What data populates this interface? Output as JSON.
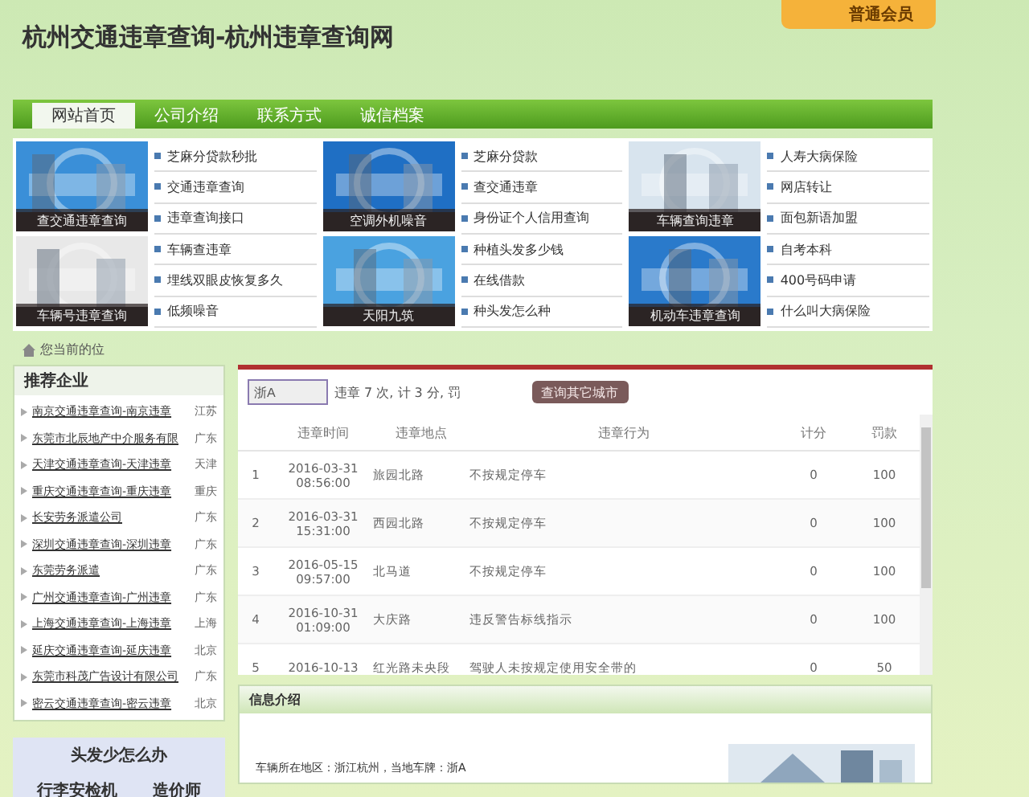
{
  "header": {
    "title": "杭州交通违章查询-杭州违章查询网",
    "member_badge": "普通会员"
  },
  "nav": [
    {
      "label": "网站首页",
      "selected": true
    },
    {
      "label": "公司介绍",
      "selected": false
    },
    {
      "label": "联系方式",
      "selected": false
    },
    {
      "label": "诚信档案",
      "selected": false
    }
  ],
  "promo_columns": [
    {
      "tiles": [
        {
          "kind": "picture",
          "caption": "查交通违章查询"
        },
        {
          "kind": "picture",
          "caption": "车辆号违章查询"
        }
      ],
      "links": [
        "芝麻分贷款秒批",
        "交通违章查询",
        "违章查询接口",
        "车辆查违章",
        "埋线双眼皮恢复多久",
        "低频噪音"
      ]
    },
    {
      "tiles": [
        {
          "kind": "picture",
          "caption": "空调外机噪音"
        },
        {
          "kind": "picture",
          "caption": "天阳九筑"
        }
      ],
      "links": [
        "芝麻分贷款",
        "查交通违章",
        "身份证个人信用查询",
        "种植头发多少钱",
        "在线借款",
        "种头发怎么种"
      ]
    },
    {
      "tiles": [
        {
          "kind": "picture",
          "caption": "车辆查询违章"
        },
        {
          "kind": "picture",
          "caption": "机动车违章查询"
        }
      ],
      "links": [
        "人寿大病保险",
        "网店转让",
        "面包新语加盟",
        "自考本科",
        "400号码申请",
        "什么叫大病保险"
      ]
    }
  ],
  "breadcrumb": "您当前的位",
  "sidebar": {
    "title": "推荐企业",
    "items": [
      {
        "name": "南京交通违章查询-南京违章",
        "region": "江苏"
      },
      {
        "name": "东莞市北辰地产中介服务有限",
        "region": "广东"
      },
      {
        "name": "天津交通违章查询-天津违章",
        "region": "天津"
      },
      {
        "name": "重庆交通违章查询-重庆违章",
        "region": "重庆"
      },
      {
        "name": "长安劳务派遣公司",
        "region": "广东"
      },
      {
        "name": "深圳交通违章查询-深圳违章",
        "region": "广东"
      },
      {
        "name": "东莞劳务派遣",
        "region": "广东"
      },
      {
        "name": "广州交通违章查询-广州违章",
        "region": "广东"
      },
      {
        "name": "上海交通违章查询-上海违章",
        "region": "上海"
      },
      {
        "name": "延庆交通违章查询-延庆违章",
        "region": "北京"
      },
      {
        "name": "东莞市科茂广告设计有限公司",
        "region": "广东"
      },
      {
        "name": "密云交通违章查询-密云违章",
        "region": "北京"
      }
    ]
  },
  "side_box": {
    "title": "头发少怎么办",
    "links": [
      "行李安检机",
      "造价师"
    ]
  },
  "query": {
    "plate_value": "浙A",
    "summary": "违章 7 次, 计 3 分, 罚",
    "other_city_button": "查询其它城市"
  },
  "table": {
    "columns": [
      "违章时间",
      "违章地点",
      "违章行为",
      "计分",
      "罚款"
    ],
    "rows": [
      {
        "index": "1",
        "date": "2016-03-31",
        "time": "08:56:00",
        "place": "旅园北路",
        "action": "不按规定停车",
        "points": "0",
        "fine": "100"
      },
      {
        "index": "2",
        "date": "2016-03-31",
        "time": "15:31:00",
        "place": "西园北路",
        "action": "不按规定停车",
        "points": "0",
        "fine": "100"
      },
      {
        "index": "3",
        "date": "2016-05-15",
        "time": "09:57:00",
        "place": "北马道",
        "action": "不按规定停车",
        "points": "0",
        "fine": "100"
      },
      {
        "index": "4",
        "date": "2016-10-31",
        "time": "01:09:00",
        "place": "大庆路",
        "action": "违反警告标线指示",
        "points": "0",
        "fine": "100"
      },
      {
        "index": "5",
        "date": "2016-10-13",
        "place": "红光路未央段",
        "action": "驾驶人未按规定使用安全带的",
        "points": "0",
        "fine": "50"
      }
    ]
  },
  "info": {
    "title": "信息介绍",
    "text": "车辆所在地区：浙江杭州，当地车牌：浙A"
  }
}
